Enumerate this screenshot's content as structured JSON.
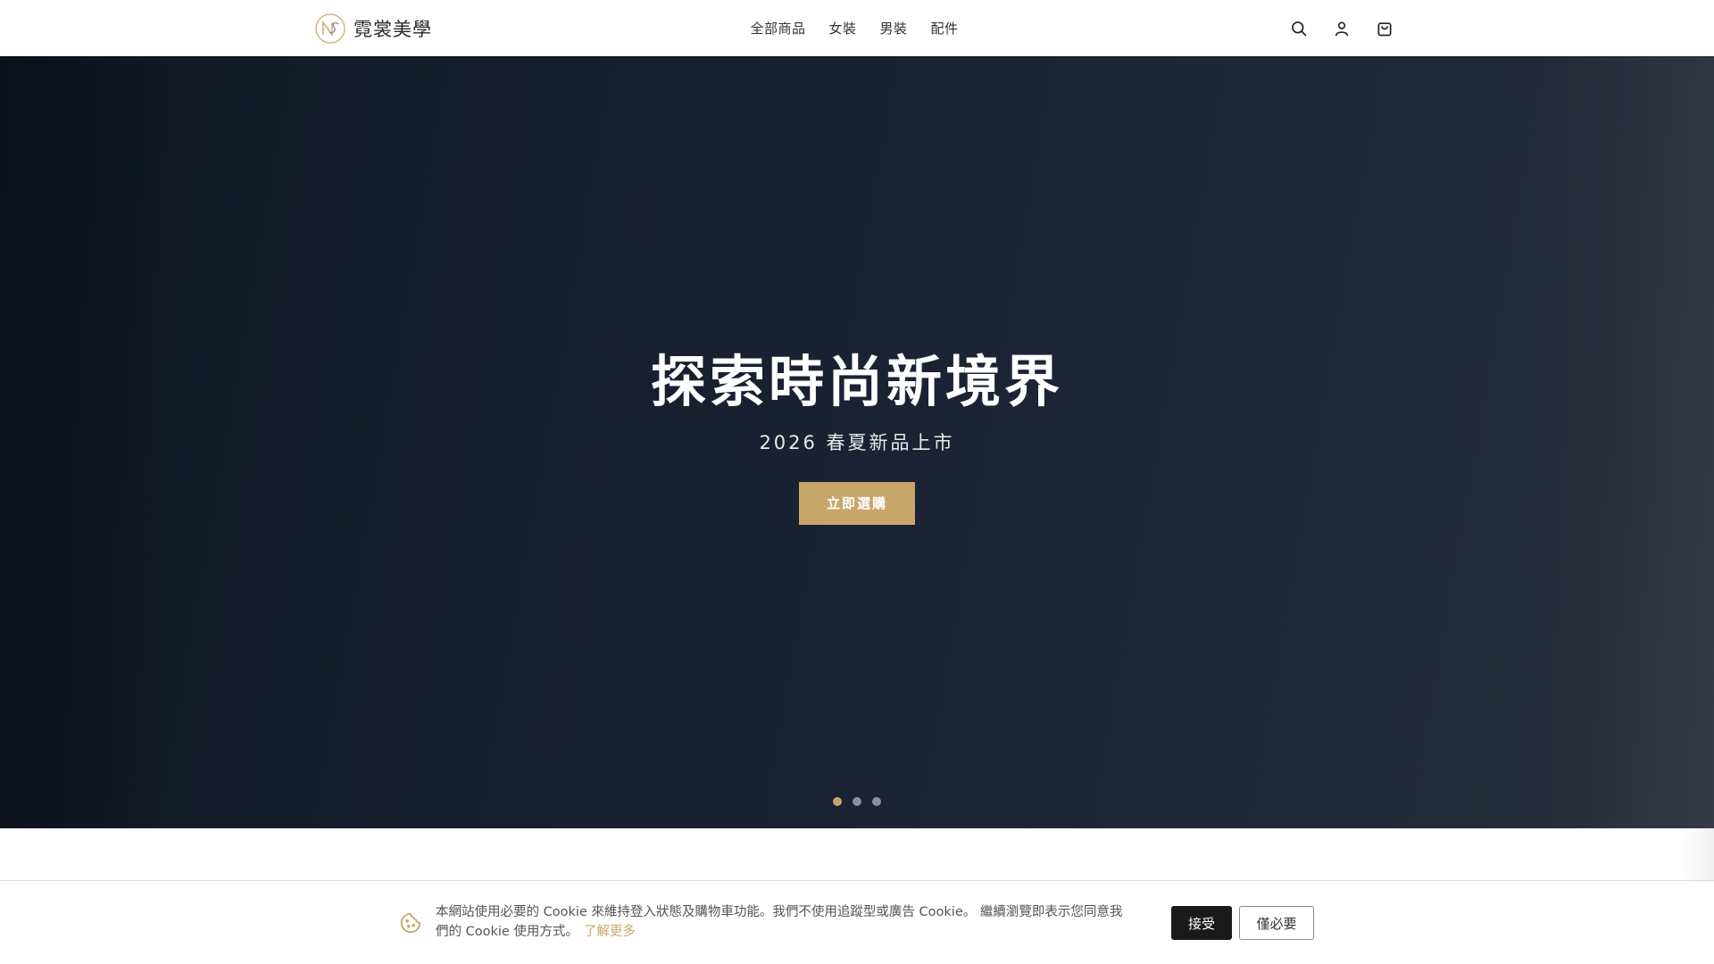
{
  "header": {
    "logo_text": "霓裳美學",
    "logo_icon": "ns-monogram-logo",
    "nav": [
      {
        "label": "全部商品"
      },
      {
        "label": "女裝"
      },
      {
        "label": "男裝"
      },
      {
        "label": "配件"
      }
    ],
    "icons": [
      "search-icon",
      "account-icon",
      "cart-icon"
    ]
  },
  "hero": {
    "title": "探索時尚新境界",
    "subtitle": "2026 春夏新品上市",
    "cta_label": "立即選購",
    "slide_count": 3,
    "active_slide": 1
  },
  "cookie": {
    "icon": "cookie-icon",
    "message": "本網站使用必要的 Cookie 來維持登入狀態及購物車功能。我們不使用追蹤型或廣告 Cookie。 繼續瀏覽即表示您同意我們的 Cookie 使用方式。",
    "learn_more": "了解更多",
    "accept_label": "接受",
    "necessary_label": "僅必要"
  },
  "colors": {
    "accent_gold": "#c8a66a",
    "hero_dark": "#161d2d",
    "button_dark": "#1a1a1a"
  }
}
